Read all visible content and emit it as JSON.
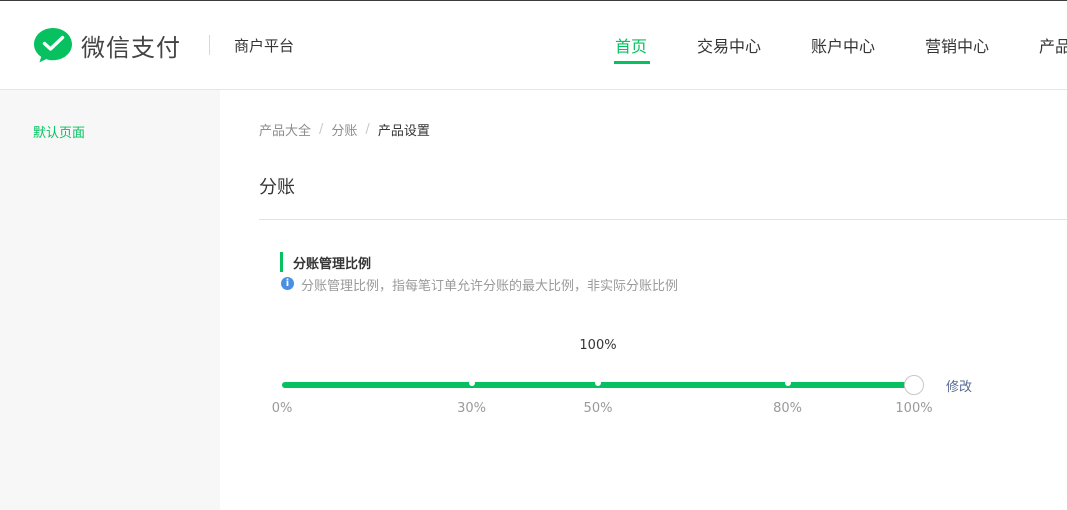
{
  "header": {
    "brand": "微信支付",
    "platform": "商户平台",
    "nav": [
      {
        "label": "首页",
        "active": true
      },
      {
        "label": "交易中心",
        "active": false
      },
      {
        "label": "账户中心",
        "active": false
      },
      {
        "label": "营销中心",
        "active": false
      },
      {
        "label": "产品",
        "active": false
      }
    ]
  },
  "sidebar": {
    "items": [
      {
        "label": "默认页面",
        "active": true
      }
    ]
  },
  "breadcrumb": {
    "items": [
      "产品大全",
      "分账",
      "产品设置"
    ],
    "separator": "/"
  },
  "page": {
    "title": "分账"
  },
  "section": {
    "title": "分账管理比例",
    "description": "分账管理比例，指每笔订单允许分账的最大比例，非实际分账比例",
    "info_icon": "info-icon"
  },
  "slider": {
    "value_label": "100%",
    "value": 100,
    "min": 0,
    "max": 100,
    "marks": [
      {
        "value": 0,
        "label": "0%"
      },
      {
        "value": 30,
        "label": "30%"
      },
      {
        "value": 50,
        "label": "50%"
      },
      {
        "value": 80,
        "label": "80%"
      },
      {
        "value": 100,
        "label": "100%"
      }
    ],
    "edit_label": "修改"
  },
  "colors": {
    "brand_green": "#07c160",
    "link_blue": "#576b95",
    "info_blue": "#4a90e2"
  }
}
